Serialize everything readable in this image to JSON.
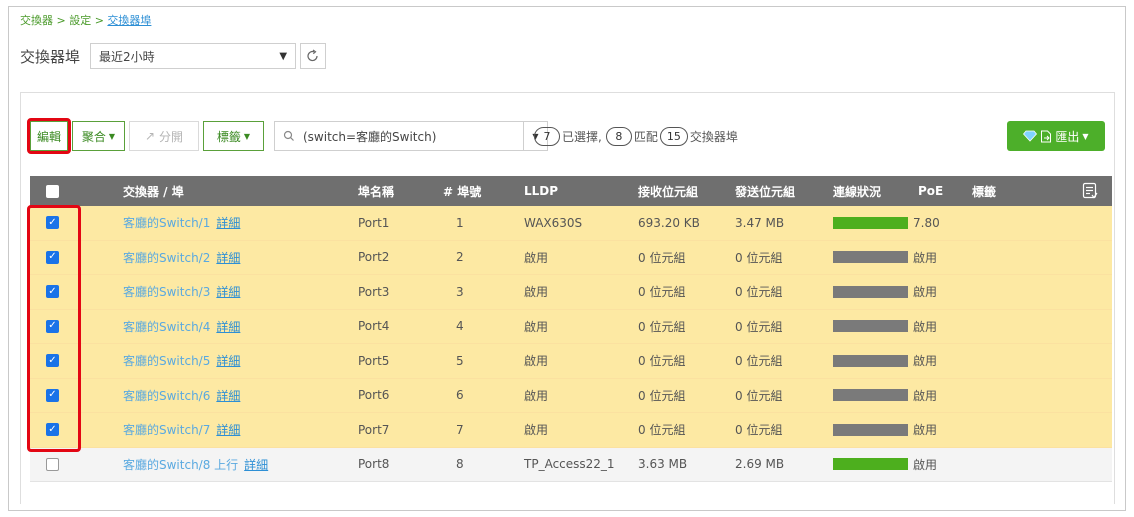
{
  "breadcrumb": {
    "part1": "交換器 > 設定 > ",
    "current": "交換器埠"
  },
  "page_title": "交換器埠",
  "time_range": {
    "value": "最近2小時"
  },
  "toolbar": {
    "edit": "編輯",
    "aggregate": "聚合",
    "split": "分開",
    "tags": "標籤",
    "filter_value": "(switch=客廳的Switch)",
    "selected_count": "7",
    "selected_label": "已選擇,",
    "matched_count": "8",
    "matched_label": "匹配",
    "total_count": "15",
    "total_label": "交換器埠",
    "export": "匯出"
  },
  "table": {
    "headers": {
      "switch_port": "交換器 / 埠",
      "port_name": "埠名稱",
      "port_no": "# 埠號",
      "lldp": "LLDP",
      "rx": "接收位元組",
      "tx": "發送位元組",
      "status": "連線狀況",
      "poe": "PoE",
      "tags": "標籤"
    },
    "detail_label": "詳細",
    "rows": [
      {
        "switch": "客廳的Switch/1",
        "port_name": "Port1",
        "port_no": "1",
        "lldp": "WAX630S",
        "rx": "693.20 KB",
        "tx": "3.47 MB",
        "poe": "7.80",
        "checked": true,
        "status_color": "#4daf1e"
      },
      {
        "switch": "客廳的Switch/2",
        "port_name": "Port2",
        "port_no": "2",
        "lldp": "啟用",
        "rx": "0 位元組",
        "tx": "0 位元組",
        "poe": "啟用",
        "checked": true,
        "status_color": "#7a7a7a"
      },
      {
        "switch": "客廳的Switch/3",
        "port_name": "Port3",
        "port_no": "3",
        "lldp": "啟用",
        "rx": "0 位元組",
        "tx": "0 位元組",
        "poe": "啟用",
        "checked": true,
        "status_color": "#7a7a7a"
      },
      {
        "switch": "客廳的Switch/4",
        "port_name": "Port4",
        "port_no": "4",
        "lldp": "啟用",
        "rx": "0 位元組",
        "tx": "0 位元組",
        "poe": "啟用",
        "checked": true,
        "status_color": "#7a7a7a"
      },
      {
        "switch": "客廳的Switch/5",
        "port_name": "Port5",
        "port_no": "5",
        "lldp": "啟用",
        "rx": "0 位元組",
        "tx": "0 位元組",
        "poe": "啟用",
        "checked": true,
        "status_color": "#7a7a7a"
      },
      {
        "switch": "客廳的Switch/6",
        "port_name": "Port6",
        "port_no": "6",
        "lldp": "啟用",
        "rx": "0 位元組",
        "tx": "0 位元組",
        "poe": "啟用",
        "checked": true,
        "status_color": "#7a7a7a"
      },
      {
        "switch": "客廳的Switch/7",
        "port_name": "Port7",
        "port_no": "7",
        "lldp": "啟用",
        "rx": "0 位元組",
        "tx": "0 位元組",
        "poe": "啟用",
        "checked": true,
        "status_color": "#7a7a7a"
      },
      {
        "switch": "客廳的Switch/8 上行",
        "port_name": "Port8",
        "port_no": "8",
        "lldp": "TP_Access22_1",
        "rx": "3.63 MB",
        "tx": "2.69 MB",
        "poe": "啟用",
        "checked": false,
        "status_color": "#4daf1e"
      }
    ]
  },
  "colors": {
    "accent": "#4daf2a",
    "highlight": "#e30613",
    "selected_row": "#fde9a3"
  }
}
